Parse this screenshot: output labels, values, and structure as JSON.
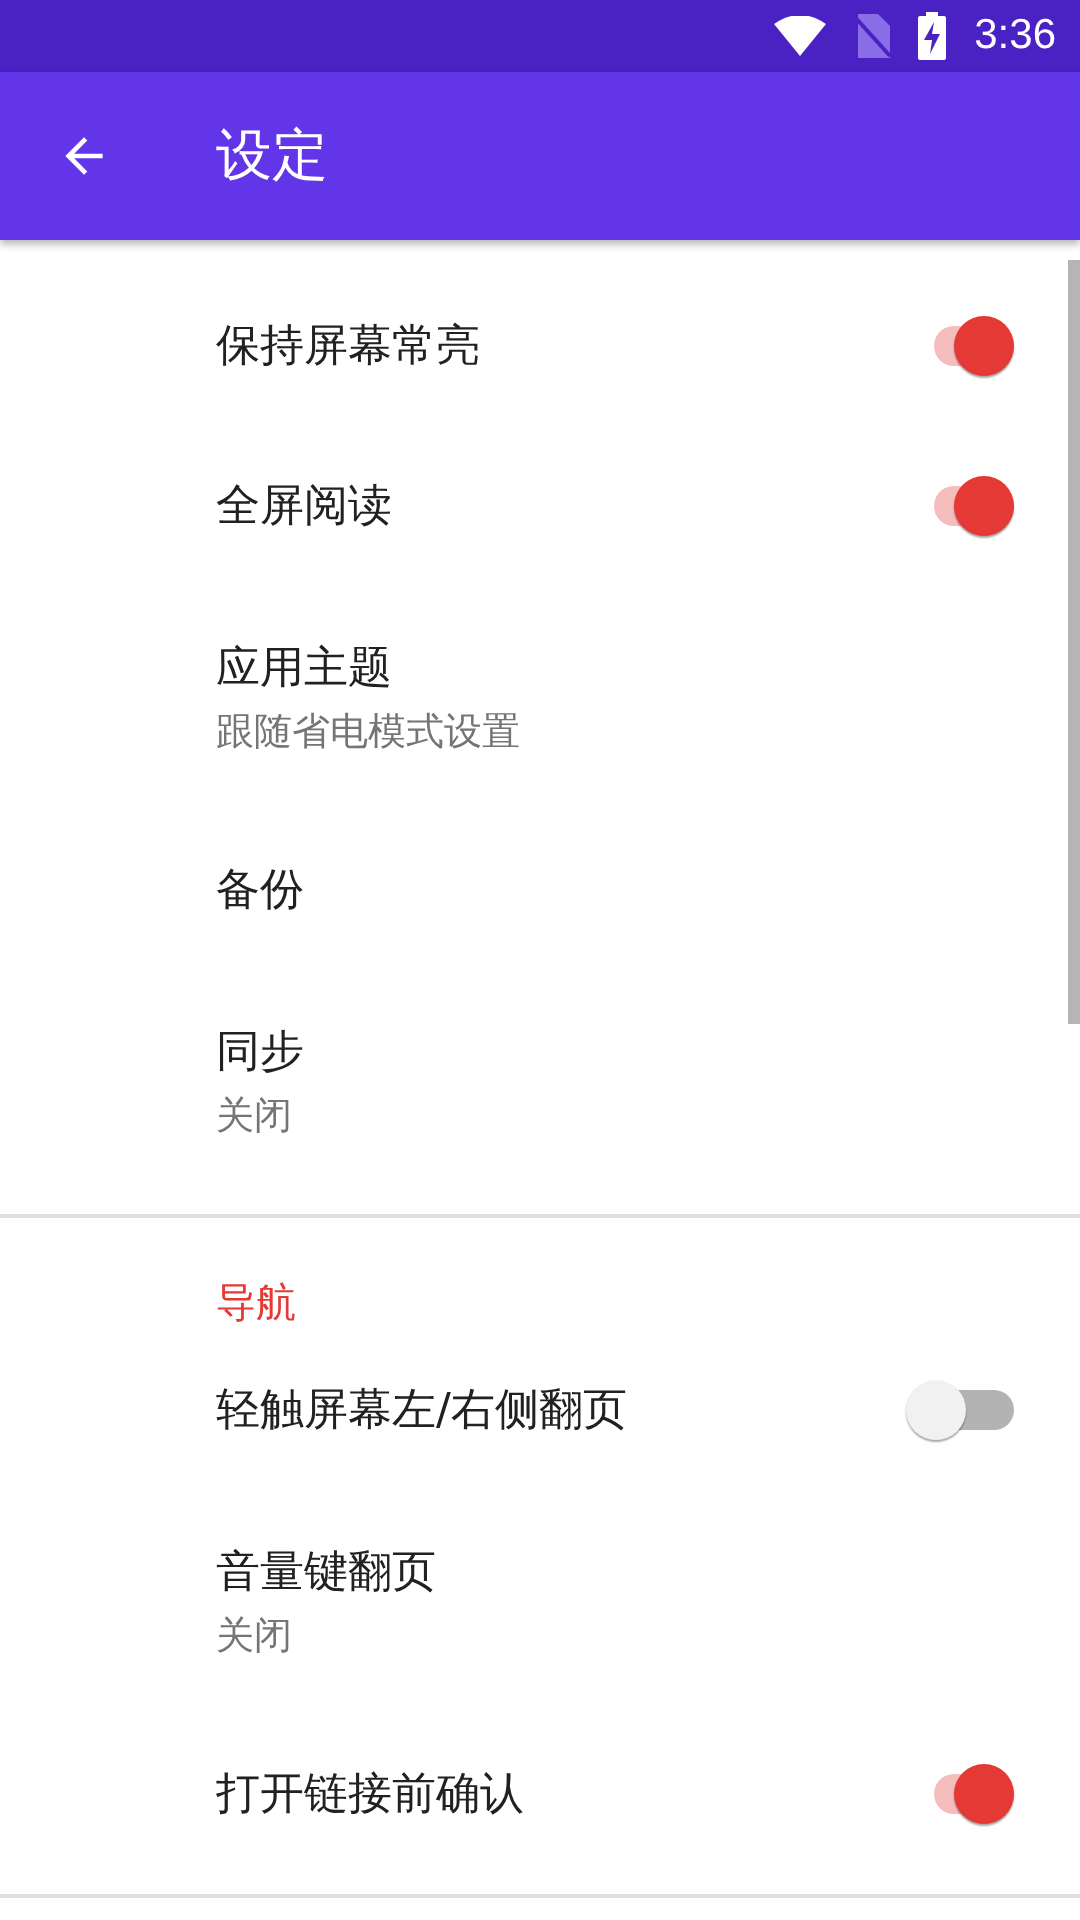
{
  "status_bar": {
    "time": "3:36"
  },
  "app_bar": {
    "title": "设定"
  },
  "sections": [
    {
      "items": [
        {
          "kind": "switch",
          "title": "保持屏幕常亮",
          "on": true
        },
        {
          "kind": "switch",
          "title": "全屏阅读",
          "on": true
        },
        {
          "kind": "text",
          "title": "应用主题",
          "summary": "跟随省电模式设置"
        },
        {
          "kind": "text",
          "title": "备份"
        },
        {
          "kind": "text",
          "title": "同步",
          "summary": "关闭"
        }
      ]
    },
    {
      "header": "导航",
      "items": [
        {
          "kind": "switch",
          "title": "轻触屏幕左/右侧翻页",
          "on": false
        },
        {
          "kind": "text",
          "title": "音量键翻页",
          "summary": "关闭"
        },
        {
          "kind": "switch",
          "title": "打开链接前确认",
          "on": true
        }
      ]
    }
  ]
}
